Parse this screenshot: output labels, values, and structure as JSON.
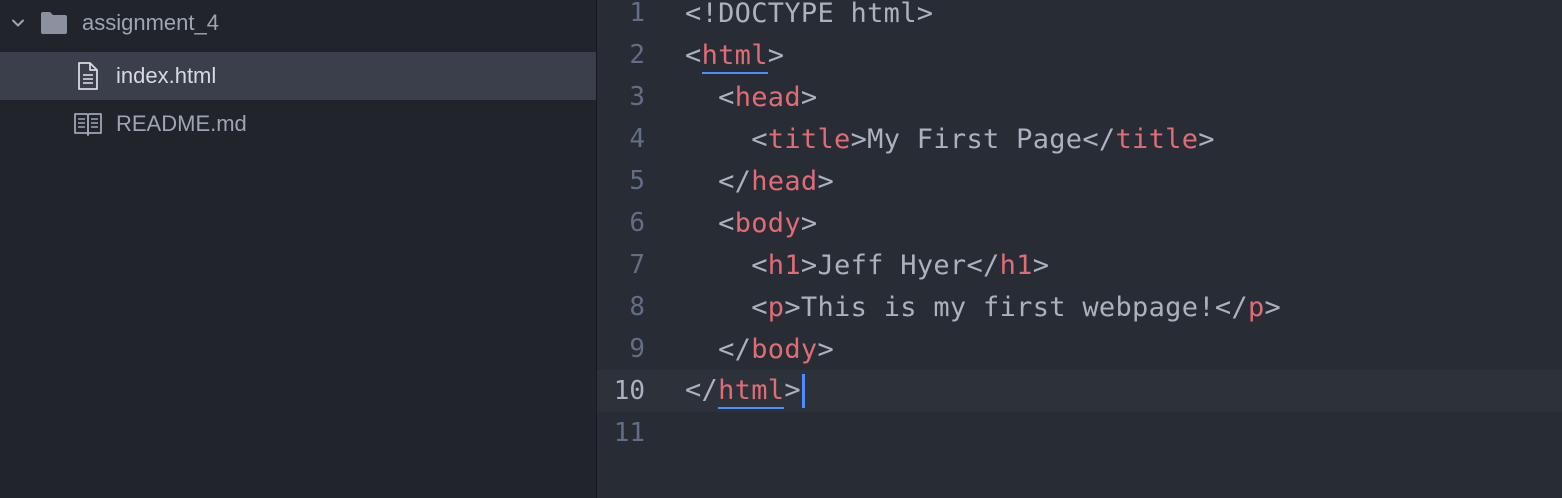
{
  "sidebar": {
    "folder": {
      "name": "assignment_4",
      "expanded": true,
      "icon": "folder-icon"
    },
    "files": [
      {
        "name": "index.html",
        "icon": "file-text-icon",
        "selected": true
      },
      {
        "name": "README.md",
        "icon": "book-icon",
        "selected": false
      }
    ]
  },
  "editor": {
    "active_line": 10,
    "lines": [
      {
        "number": "1",
        "indent": "",
        "parts": [
          {
            "t": "<!DOCTYPE html>",
            "c": "punct"
          }
        ]
      },
      {
        "number": "2",
        "indent": "",
        "parts": [
          {
            "t": "<",
            "c": "punct"
          },
          {
            "t": "html",
            "c": "tag underline"
          },
          {
            "t": ">",
            "c": "punct"
          }
        ]
      },
      {
        "number": "3",
        "indent": "  ",
        "parts": [
          {
            "t": "<",
            "c": "punct"
          },
          {
            "t": "head",
            "c": "tag"
          },
          {
            "t": ">",
            "c": "punct"
          }
        ]
      },
      {
        "number": "4",
        "indent": "    ",
        "parts": [
          {
            "t": "<",
            "c": "punct"
          },
          {
            "t": "title",
            "c": "tag"
          },
          {
            "t": ">",
            "c": "punct"
          },
          {
            "t": "My First Page",
            "c": "text"
          },
          {
            "t": "</",
            "c": "punct"
          },
          {
            "t": "title",
            "c": "tag"
          },
          {
            "t": ">",
            "c": "punct"
          }
        ]
      },
      {
        "number": "5",
        "indent": "  ",
        "parts": [
          {
            "t": "</",
            "c": "punct"
          },
          {
            "t": "head",
            "c": "tag"
          },
          {
            "t": ">",
            "c": "punct"
          }
        ]
      },
      {
        "number": "6",
        "indent": "  ",
        "parts": [
          {
            "t": "<",
            "c": "punct"
          },
          {
            "t": "body",
            "c": "tag"
          },
          {
            "t": ">",
            "c": "punct"
          }
        ]
      },
      {
        "number": "7",
        "indent": "    ",
        "parts": [
          {
            "t": "<",
            "c": "punct"
          },
          {
            "t": "h1",
            "c": "tag"
          },
          {
            "t": ">",
            "c": "punct"
          },
          {
            "t": "Jeff Hyer",
            "c": "text"
          },
          {
            "t": "</",
            "c": "punct"
          },
          {
            "t": "h1",
            "c": "tag"
          },
          {
            "t": ">",
            "c": "punct"
          }
        ]
      },
      {
        "number": "8",
        "indent": "    ",
        "parts": [
          {
            "t": "<",
            "c": "punct"
          },
          {
            "t": "p",
            "c": "tag"
          },
          {
            "t": ">",
            "c": "punct"
          },
          {
            "t": "This is my first webpage!",
            "c": "text"
          },
          {
            "t": "</",
            "c": "punct"
          },
          {
            "t": "p",
            "c": "tag"
          },
          {
            "t": ">",
            "c": "punct"
          }
        ]
      },
      {
        "number": "9",
        "indent": "  ",
        "parts": [
          {
            "t": "</",
            "c": "punct"
          },
          {
            "t": "body",
            "c": "tag"
          },
          {
            "t": ">",
            "c": "punct"
          }
        ]
      },
      {
        "number": "10",
        "indent": "",
        "parts": [
          {
            "t": "</",
            "c": "punct"
          },
          {
            "t": "html",
            "c": "tag underline"
          },
          {
            "t": ">",
            "c": "punct"
          }
        ]
      },
      {
        "number": "11",
        "indent": "",
        "parts": []
      }
    ]
  },
  "colors": {
    "sidebar_bg": "#21252b",
    "editor_bg": "#282c34",
    "selection_bg": "#3a3f4b",
    "tag": "#e06c75",
    "text": "#abb2bf",
    "cursor": "#528bff"
  }
}
